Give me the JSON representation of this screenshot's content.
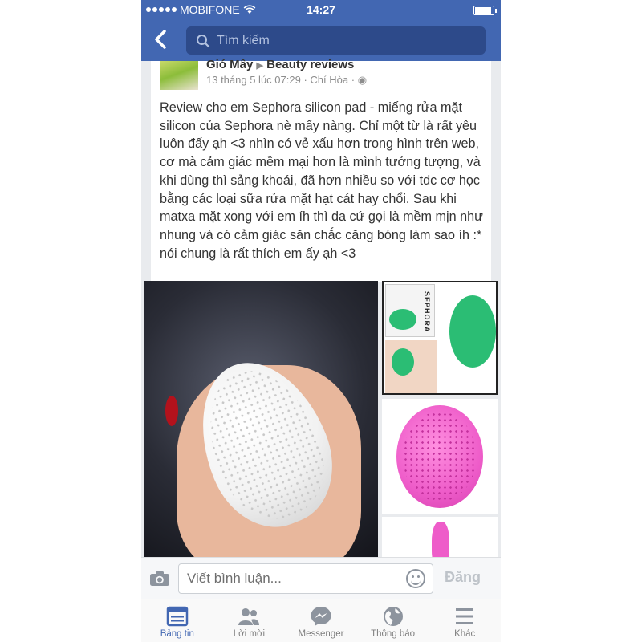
{
  "status_bar": {
    "carrier": "MOBIFONE",
    "time": "14:27"
  },
  "nav": {
    "search_placeholder": "Tìm kiếm"
  },
  "post": {
    "author": "Gió Mây",
    "group": "Beauty reviews",
    "timestamp": "13 tháng 5 lúc 07:29",
    "location": "Chí Hòa",
    "text": "Review cho em Sephora silicon pad - miếng rửa mặt silicon của Sephora nè mấy nàng. Chỉ một từ là rất yêu luôn đấy ạh <3 nhìn có vẻ xấu hơn trong hình trên web, cơ mà cảm giác mềm mại hơn là mình tưởng tượng, và khi dùng thì sảng khoái, đã hơn nhiều so với tdc cơ học bằng các loại sữa rửa mặt hạt cát hay chổi. Sau khi matxa mặt xong với em íh thì da cứ gọi là mềm mịn như nhung và có cảm giác săn chắc căng bóng làm sao íh :* nói chung là rất thích em ấy ạh <3",
    "photo_brand": "SEPHORA"
  },
  "comment": {
    "placeholder": "Viết bình luận...",
    "post_label": "Đăng"
  },
  "tabs": [
    {
      "label": "Bảng tin",
      "icon": "news-feed-icon",
      "active": true
    },
    {
      "label": "Lời mời",
      "icon": "friend-requests-icon",
      "active": false
    },
    {
      "label": "Messenger",
      "icon": "messenger-icon",
      "active": false
    },
    {
      "label": "Thông báo",
      "icon": "globe-icon",
      "active": false
    },
    {
      "label": "Khác",
      "icon": "menu-icon",
      "active": false
    }
  ],
  "colors": {
    "brand_blue": "#4267b2",
    "active_tab": "#4267b2",
    "inactive_tab": "#7f7f7f"
  }
}
